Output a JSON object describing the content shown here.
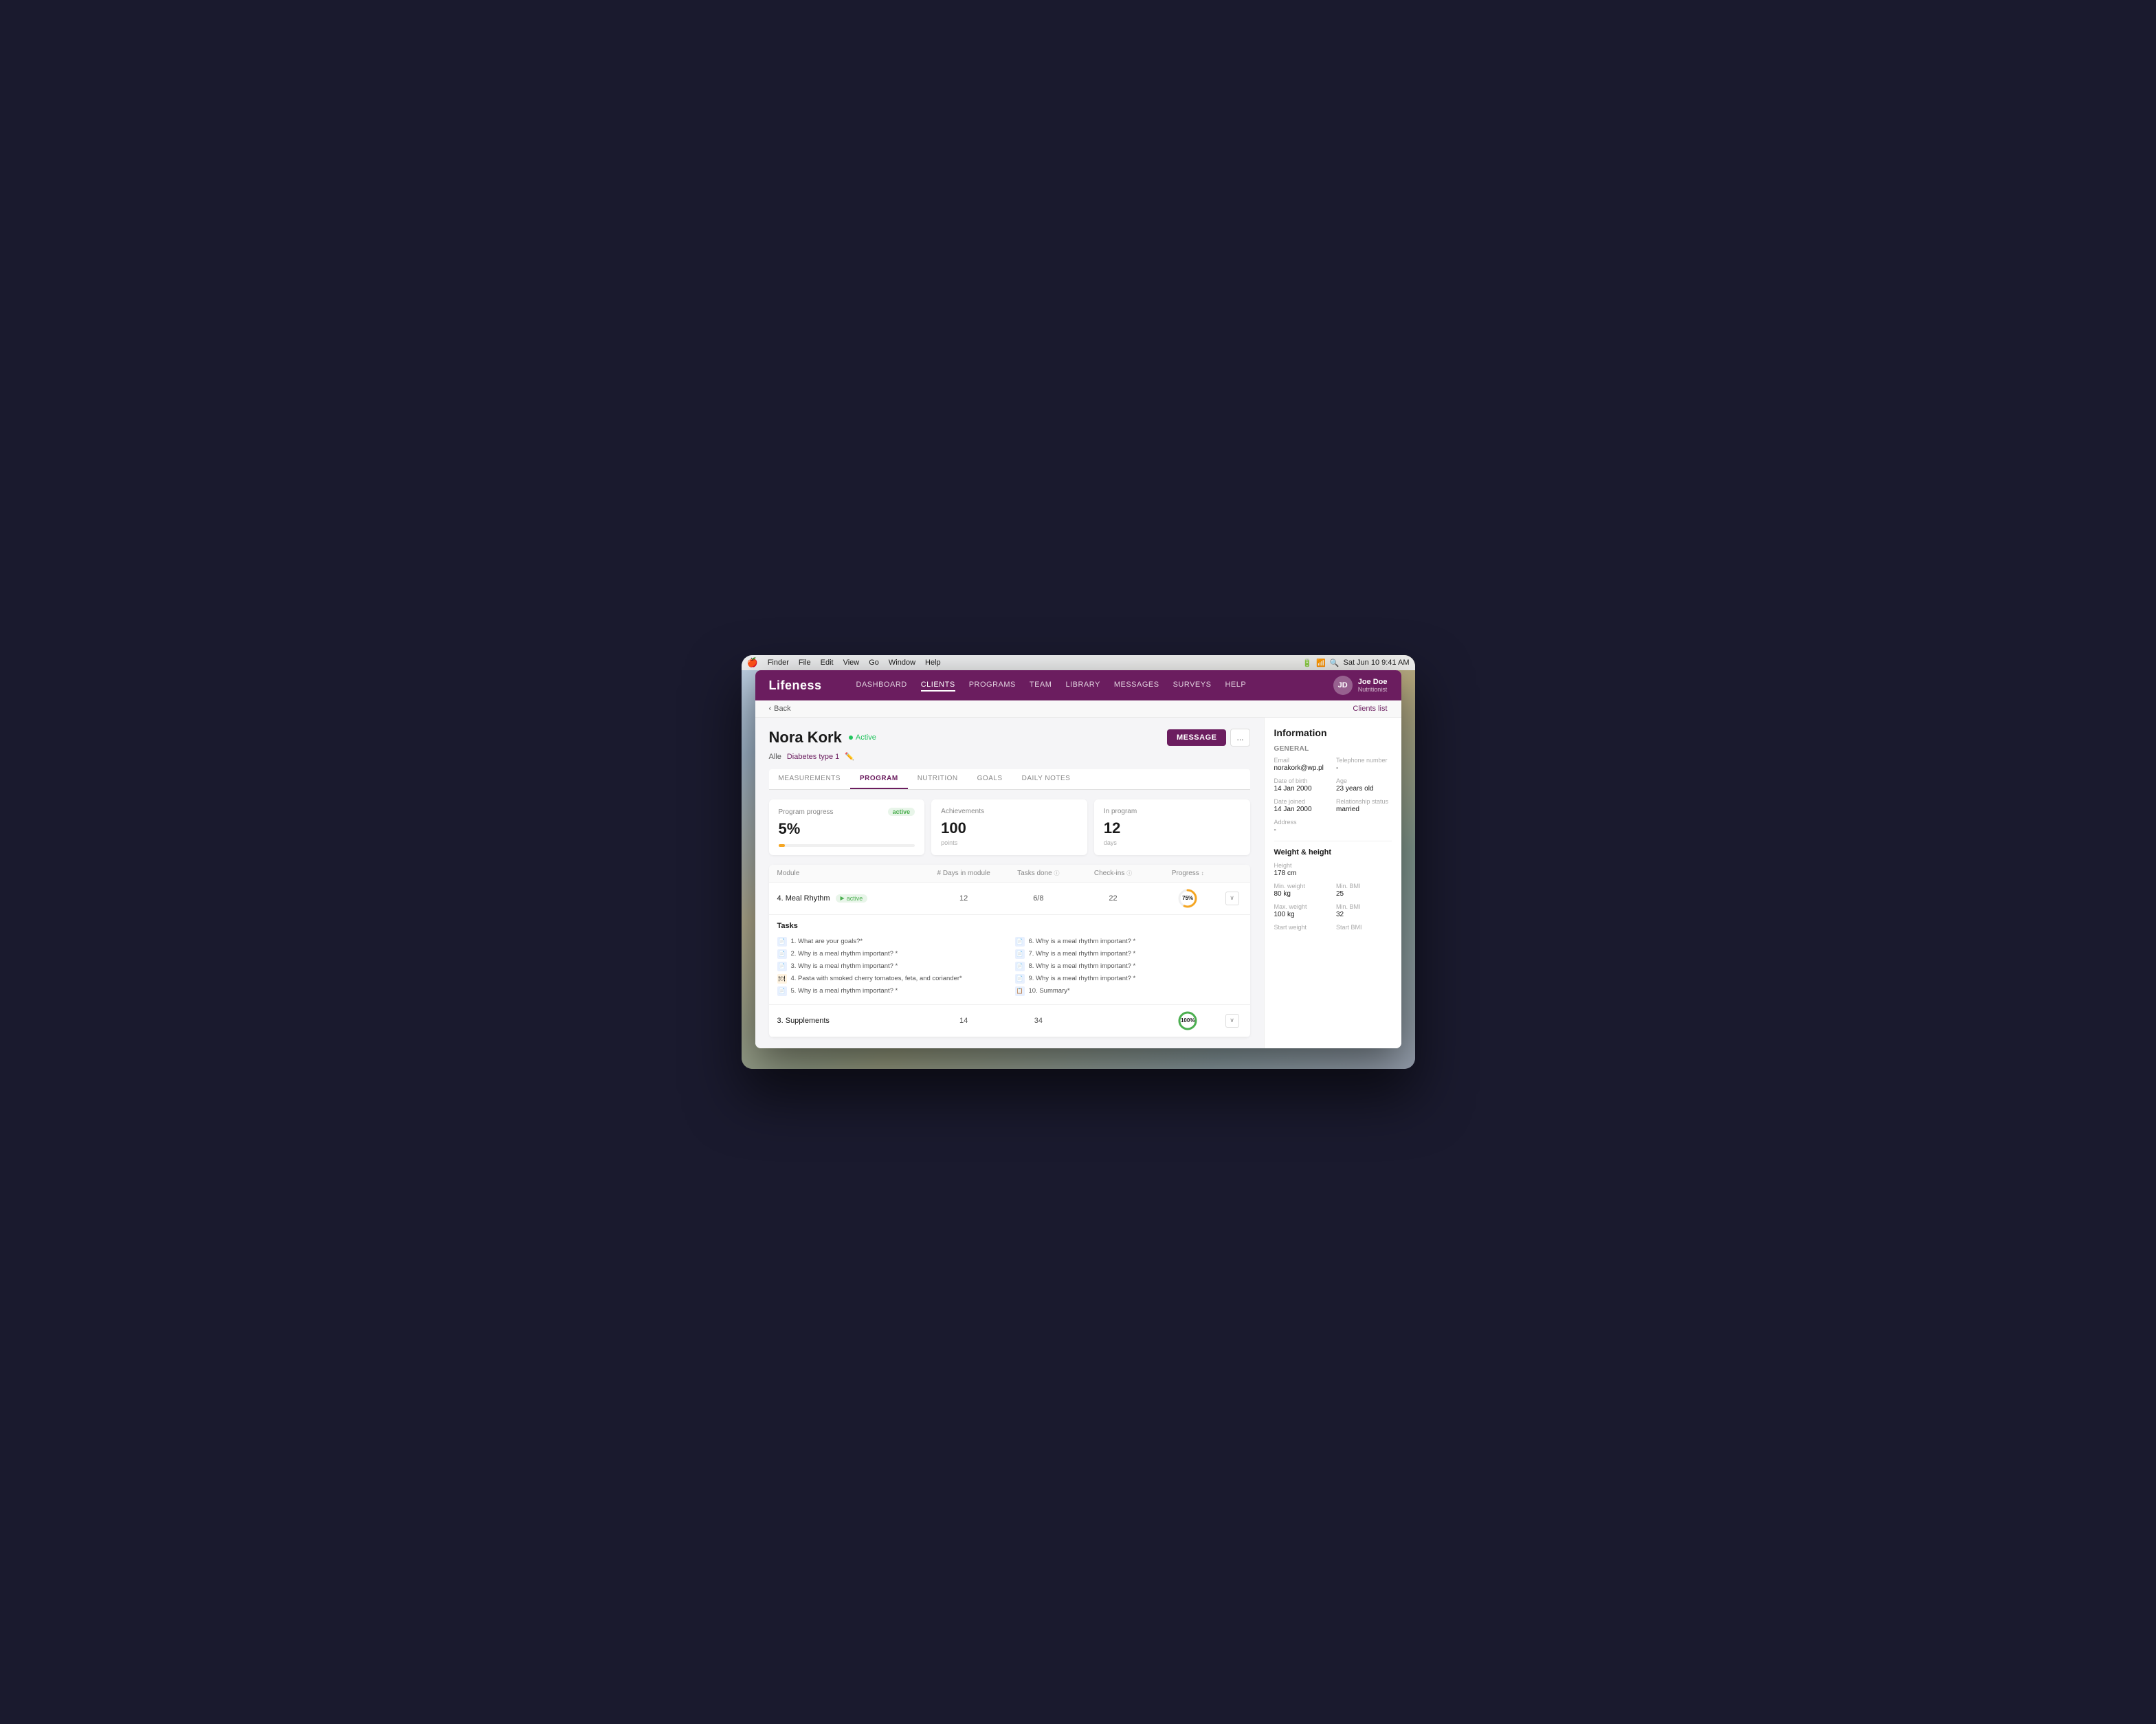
{
  "macbar": {
    "apple": "🍎",
    "menus": [
      "Finder",
      "File",
      "Edit",
      "View",
      "Go",
      "Window",
      "Help"
    ],
    "right": "Sat Jun 10  9:41 AM"
  },
  "nav": {
    "logo": "Lifeness",
    "links": [
      {
        "label": "DASHBOARD",
        "active": false
      },
      {
        "label": "CLIENTS",
        "active": true
      },
      {
        "label": "PROGRAMS",
        "active": false
      },
      {
        "label": "TEAM",
        "active": false
      },
      {
        "label": "LIBRARY",
        "active": false
      },
      {
        "label": "MESSAGES",
        "active": false
      },
      {
        "label": "SURVEYS",
        "active": false
      },
      {
        "label": "HELP",
        "active": false
      }
    ],
    "user": {
      "name": "Joe Doe",
      "role": "Nutritionist",
      "initials": "JD"
    }
  },
  "breadcrumb": {
    "back": "Back",
    "clients_list": "Clients list"
  },
  "client": {
    "name": "Nora Kork",
    "status": "Active",
    "tags": [
      "Alle",
      "Diabetes type 1"
    ],
    "message_btn": "MESSAGE",
    "more_btn": "..."
  },
  "tabs": [
    "MEASUREMENTS",
    "PROGRAM",
    "NUTRITION",
    "GOALS",
    "DAILY NOTES"
  ],
  "active_tab": "PROGRAM",
  "stats": [
    {
      "label": "Program progress",
      "badge": "active",
      "value": "5%",
      "has_progress_bar": true
    },
    {
      "label": "Achievements",
      "value": "100",
      "sublabel": "points"
    },
    {
      "label": "In program",
      "value": "12",
      "sublabel": "days"
    }
  ],
  "table": {
    "headers": [
      "Module",
      "# Days in module",
      "Tasks done",
      "Check-ins",
      "Progress"
    ],
    "rows": [
      {
        "name": "4. Meal Rhythm",
        "status": "active",
        "days": "12",
        "tasks": "6/8",
        "checkins": "22",
        "progress": 75,
        "expanded": true
      },
      {
        "name": "3. Supplements",
        "status": "",
        "days": "14",
        "tasks": "34",
        "checkins": "",
        "progress": 100,
        "expanded": false
      }
    ]
  },
  "tasks": {
    "title": "Tasks",
    "items": [
      {
        "num": "1.",
        "text": "What are your goals?*",
        "type": "doc"
      },
      {
        "num": "6.",
        "text": "Why is a meal rhythm important? *",
        "type": "doc"
      },
      {
        "num": "2.",
        "text": "Why is a meal rhythm important? *",
        "type": "doc"
      },
      {
        "num": "7.",
        "text": "Why is a meal rhythm important? *",
        "type": "doc"
      },
      {
        "num": "3.",
        "text": "Why is a meal rhythm important? *",
        "type": "doc"
      },
      {
        "num": "8.",
        "text": "Why is a meal rhythm important? *",
        "type": "doc"
      },
      {
        "num": "4.",
        "text": "Pasta with smoked cherry tomatoes, feta, and coriander*",
        "type": "recipe"
      },
      {
        "num": "9.",
        "text": "Why is a meal rhythm important? *",
        "type": "doc"
      },
      {
        "num": "5.",
        "text": "Why is a meal rhythm important? *",
        "type": "doc"
      },
      {
        "num": "10.",
        "text": "Summary*",
        "type": "summary"
      }
    ]
  },
  "info": {
    "title": "Information",
    "general_label": "General",
    "fields": [
      {
        "label": "Email",
        "value": "norakork@wp.pl",
        "col": "left"
      },
      {
        "label": "Telephone number",
        "value": "-",
        "col": "right"
      },
      {
        "label": "Date of birth",
        "value": "14 Jan 2000",
        "col": "left"
      },
      {
        "label": "Age",
        "value": "23 years old",
        "col": "right"
      },
      {
        "label": "Date joined",
        "value": "14 Jan 2000",
        "col": "left"
      },
      {
        "label": "Relationship status",
        "value": "married",
        "col": "right"
      },
      {
        "label": "Address",
        "value": "-",
        "col": "left"
      }
    ],
    "weight_height_title": "Weight & height",
    "wh_fields": [
      {
        "label": "Height",
        "value": "178 cm"
      },
      {
        "label": "Min. weight",
        "value": "80 kg"
      },
      {
        "label": "Min. BMI",
        "value": "25"
      },
      {
        "label": "Max. weight",
        "value": "100 kg"
      },
      {
        "label": "Min. BMI",
        "value": "32"
      },
      {
        "label": "Start weight",
        "value": ""
      },
      {
        "label": "Start BMI",
        "value": ""
      }
    ]
  }
}
